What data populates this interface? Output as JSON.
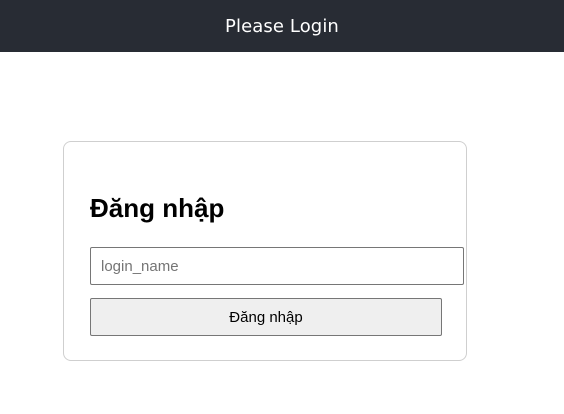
{
  "header": {
    "title": "Please Login"
  },
  "login_card": {
    "heading": "Đăng nhập",
    "login_input": {
      "value": "",
      "placeholder": "login_name"
    },
    "submit_label": "Đăng nhập"
  },
  "colors": {
    "header_background": "#282c34",
    "header_text": "#ffffff",
    "card_border": "#cfcfcf",
    "button_background": "#efefef"
  }
}
